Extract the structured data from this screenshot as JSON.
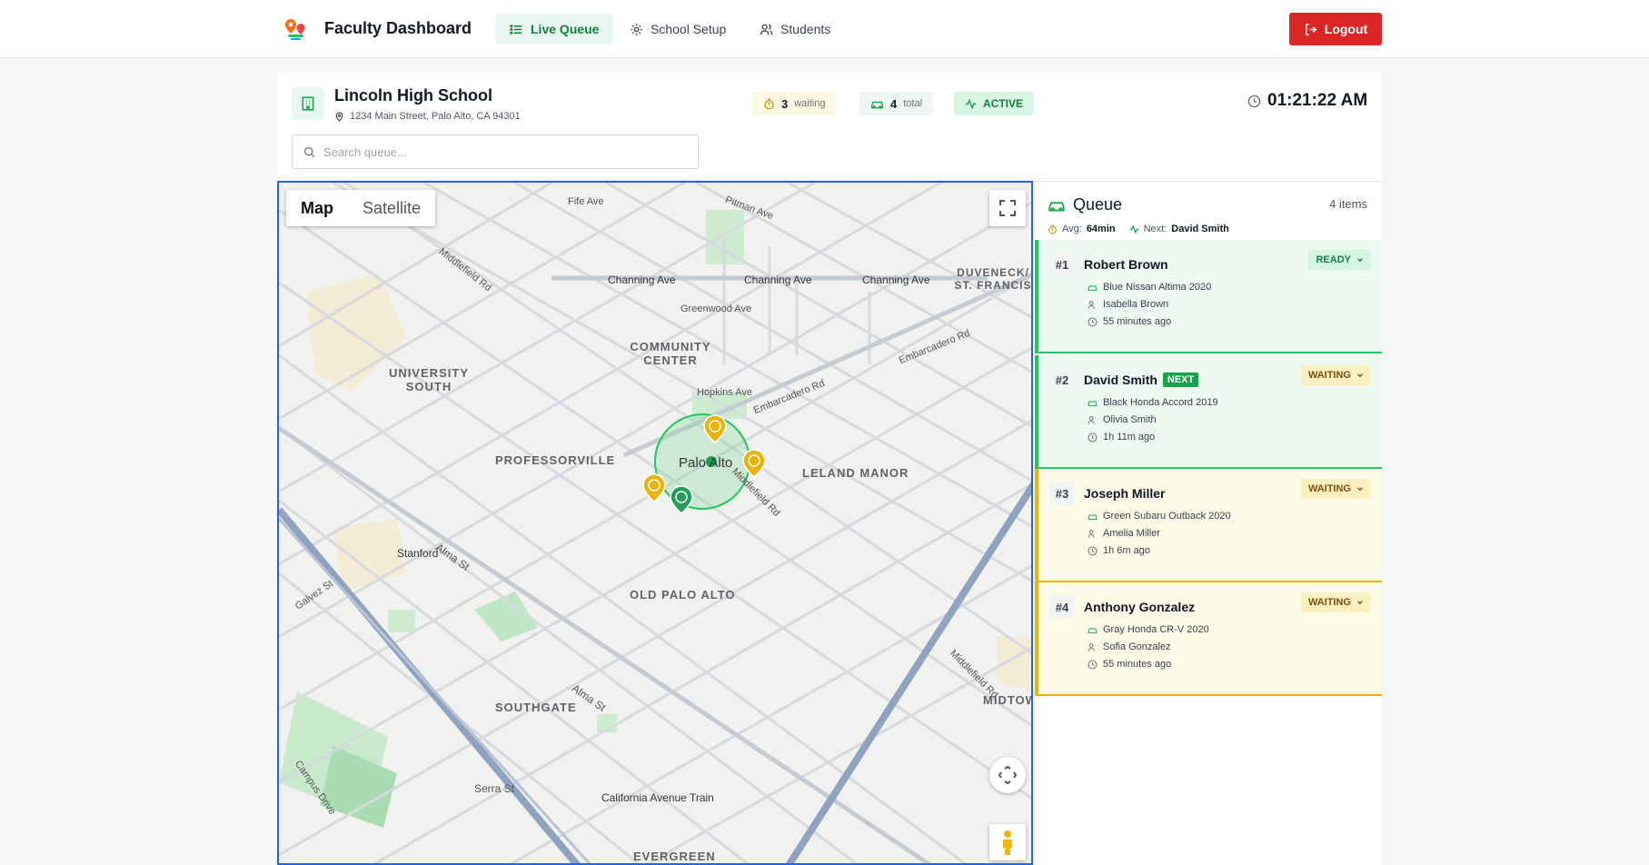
{
  "nav": {
    "title": "Faculty Dashboard",
    "tabs": [
      {
        "label": "Live Queue",
        "icon": "list-icon",
        "active": true
      },
      {
        "label": "School Setup",
        "icon": "gear-icon",
        "active": false
      },
      {
        "label": "Students",
        "icon": "users-icon",
        "active": false
      }
    ],
    "logout_label": "Logout"
  },
  "school": {
    "name": "Lincoln High School",
    "address": "1234 Main Street, Palo Alto, CA 94301"
  },
  "stats": {
    "waiting_count": "3",
    "waiting_label": "waiting",
    "total_count": "4",
    "total_label": "total",
    "status": "ACTIVE"
  },
  "clock": "01:21:22 AM",
  "search": {
    "placeholder": "Search queue..."
  },
  "map": {
    "type_map": "Map",
    "type_satellite": "Satellite",
    "labels": {
      "palo_alto": "Palo Alto",
      "professorville": "PROFESSORVILLE",
      "leland_manor": "LELAND MANOR",
      "old_palo_alto": "OLD PALO ALTO",
      "southgate": "SOUTHGATE",
      "community_center": "COMMUNITY CENTER",
      "university_south": "UNIVERSITY SOUTH",
      "duveneck": "DUVENECK/ ST. FRANCIS",
      "evergreen": "EVERGREEN",
      "midtown": "MIDTOW",
      "stanford": "Stanford",
      "channing": "Channing Ave",
      "embarcadero": "Embarcadero Rd",
      "middlefield": "Middlefield Rd",
      "alma": "Alma St",
      "california_train": "California Avenue Train",
      "serra": "Serra St",
      "galvez": "Galvez St",
      "campus_drive": "Campus Drive",
      "hopkins": "Hopkins Ave",
      "greenwood": "Greenwood Ave",
      "fife": "Fife Ave",
      "pitman": "Pitman Ave"
    }
  },
  "queue": {
    "title": "Queue",
    "count": "4 items",
    "avg_label": "Avg:",
    "avg_value": "64min",
    "next_label": "Next:",
    "next_value": "David Smith",
    "next_badge": "NEXT",
    "items": [
      {
        "num": "#1",
        "name": "Robert Brown",
        "status": "READY",
        "vehicle": "Blue Nissan Altima 2020",
        "student": "Isabella Brown",
        "time": "55 minutes ago"
      },
      {
        "num": "#2",
        "name": "David Smith",
        "status": "WAITING",
        "vehicle": "Black Honda Accord 2019",
        "student": "Olivia Smith",
        "time": "1h 11m ago"
      },
      {
        "num": "#3",
        "name": "Joseph Miller",
        "status": "WAITING",
        "vehicle": "Green Subaru Outback 2020",
        "student": "Amelia Miller",
        "time": "1h 6m ago"
      },
      {
        "num": "#4",
        "name": "Anthony Gonzalez",
        "status": "WAITING",
        "vehicle": "Gray Honda CR-V 2020",
        "student": "Sofia Gonzalez",
        "time": "55 minutes ago"
      }
    ]
  },
  "colors": {
    "accent": "#16a34a",
    "danger": "#dc2626",
    "warning": "#eab308",
    "map_border": "#2563eb"
  }
}
